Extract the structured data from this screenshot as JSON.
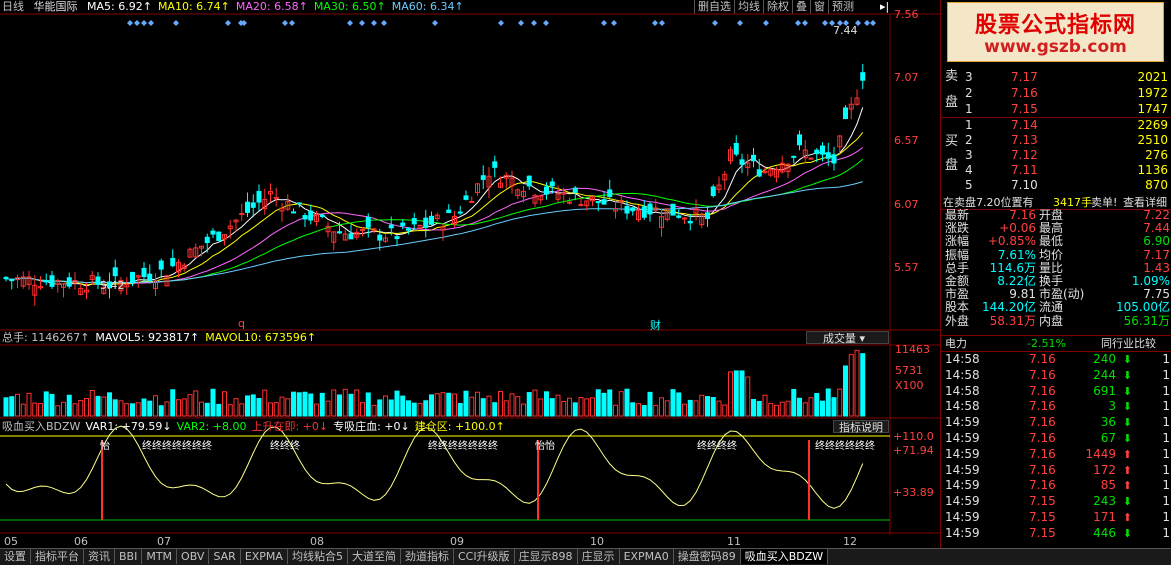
{
  "header": {
    "period": "日线",
    "stock": "华能国际",
    "ma": [
      {
        "label": "MA5: 6.92↑",
        "color": "#ffffff"
      },
      {
        "label": "MA10: 6.74↑",
        "color": "#ffff00"
      },
      {
        "label": "MA20: 6.58↑",
        "color": "#ff66ff"
      },
      {
        "label": "MA30: 6.50↑",
        "color": "#00ff00"
      },
      {
        "label": "MA60: 6.34↑",
        "color": "#66ccff"
      }
    ],
    "buttons": [
      "删自选",
      "均线",
      "除权",
      "叠",
      "窗",
      "预测"
    ],
    "play": "▸|"
  },
  "price_axis": [
    "7.56",
    "7.07",
    "6.57",
    "6.07",
    "5.57"
  ],
  "annotations": {
    "high": "7.44",
    "low": "5.42",
    "q": "q",
    "cai": "财"
  },
  "volume": {
    "header": [
      {
        "label": "总手: 1146267↑",
        "color": "#c0c0c0"
      },
      {
        "label": "MAVOL5: 923817↑",
        "color": "#ffffff"
      },
      {
        "label": "MAVOL10: 673596↑",
        "color": "#ffff00"
      }
    ],
    "button": "成交量 ▾",
    "axis": [
      "11463",
      "5731",
      "X100"
    ]
  },
  "indicator": {
    "header": [
      {
        "label": "吸血买入BDZW",
        "color": "#c0c0c0"
      },
      {
        "label": "VAR1: +79.59↓",
        "color": "#ffffff"
      },
      {
        "label": "VAR2: +8.00",
        "color": "#00ff00"
      },
      {
        "label": "上升在即: +0↓",
        "color": "#ff3030"
      },
      {
        "label": "专吸庄血: +0↓",
        "color": "#ffffff"
      },
      {
        "label": "建仓区: +100.0↑",
        "color": "#ffff00"
      }
    ],
    "button": "指标说明",
    "axis": [
      "+110.0",
      "+71.94",
      "+33.89"
    ],
    "labels": [
      "怡",
      "终终终终终终终",
      "终终终",
      "终终终终终终终",
      "怡怡",
      "终终终终",
      "终终终终终终"
    ]
  },
  "months": [
    "05",
    "06",
    "07",
    "08",
    "09",
    "10",
    "11",
    "12"
  ],
  "tabs": [
    "设置",
    "指标平台",
    "资讯",
    "BBI",
    "MTM",
    "OBV",
    "SAR",
    "EXPMA",
    "均线粘合5",
    "大道至简",
    "劲道指标",
    "CCI升级版",
    "庄显示898",
    "庄显示",
    "EXPMA0",
    "操盘密码89",
    "吸血买入BDZW"
  ],
  "ad": {
    "title": "股票公式指标网",
    "url": "www.gszb.com"
  },
  "orderbook": {
    "sell_label": "卖盘",
    "sell": [
      {
        "n": "3",
        "price": "7.17",
        "vol": "2021"
      },
      {
        "n": "2",
        "price": "7.16",
        "vol": "1972"
      },
      {
        "n": "1",
        "price": "7.15",
        "vol": "1747"
      }
    ],
    "buy_label": "买盘",
    "buy": [
      {
        "n": "1",
        "price": "7.14",
        "vol": "2269"
      },
      {
        "n": "2",
        "price": "7.13",
        "vol": "2510"
      },
      {
        "n": "3",
        "price": "7.12",
        "vol": "276"
      },
      {
        "n": "4",
        "price": "7.11",
        "vol": "1136"
      },
      {
        "n": "5",
        "price": "7.10",
        "vol": "870"
      }
    ],
    "notice": "在卖盘7.20位置有",
    "notice_vol": "3417手",
    "notice_tail": "卖单!",
    "notice_link": "查看详细"
  },
  "quote": [
    {
      "k1": "最新",
      "v1": "7.16",
      "c1": "#ff4040",
      "k2": "开盘",
      "v2": "7.22",
      "c2": "#ff4040"
    },
    {
      "k1": "涨跌",
      "v1": "+0.06",
      "c1": "#ff4040",
      "k2": "最高",
      "v2": "7.44",
      "c2": "#ff4040"
    },
    {
      "k1": "涨幅",
      "v1": "+0.85%",
      "c1": "#ff4040",
      "k2": "最低",
      "v2": "6.90",
      "c2": "#00e000"
    },
    {
      "k1": "振幅",
      "v1": "7.61%",
      "c1": "#00ffff",
      "k2": "均价",
      "v2": "7.17",
      "c2": "#ff4040"
    },
    {
      "k1": "总手",
      "v1": "114.6万",
      "c1": "#00ffff",
      "k2": "量比",
      "v2": "1.43",
      "c2": "#ff4040"
    },
    {
      "k1": "金额",
      "v1": "8.22亿",
      "c1": "#00ffff",
      "k2": "换手",
      "v2": "1.09%",
      "c2": "#00ffff"
    },
    {
      "k1": "市盈",
      "v1": "9.81",
      "c1": "#e0e0e0",
      "k2": "市盈(动)",
      "v2": "7.75",
      "c2": "#e0e0e0"
    },
    {
      "k1": "股本",
      "v1": "144.20亿",
      "c1": "#00ffff",
      "k2": "流通",
      "v2": "105.00亿",
      "c2": "#00ffff"
    },
    {
      "k1": "外盘",
      "v1": "58.31万",
      "c1": "#ff4040",
      "k2": "内盘",
      "v2": "56.31万",
      "c2": "#00e000"
    }
  ],
  "sector": {
    "name": "电力",
    "change": "-2.51%",
    "link": "同行业比较"
  },
  "ticks": [
    {
      "t": "14:58",
      "p": "7.16",
      "v": "240",
      "d": "down",
      "n": "1"
    },
    {
      "t": "14:58",
      "p": "7.16",
      "v": "244",
      "d": "down",
      "n": "1"
    },
    {
      "t": "14:58",
      "p": "7.16",
      "v": "691",
      "d": "down",
      "n": "1"
    },
    {
      "t": "14:58",
      "p": "7.16",
      "v": "3",
      "d": "down",
      "n": "1"
    },
    {
      "t": "14:59",
      "p": "7.16",
      "v": "36",
      "d": "down",
      "n": "1"
    },
    {
      "t": "14:59",
      "p": "7.16",
      "v": "67",
      "d": "down",
      "n": "1"
    },
    {
      "t": "14:59",
      "p": "7.16",
      "v": "1449",
      "d": "up",
      "n": "1"
    },
    {
      "t": "14:59",
      "p": "7.16",
      "v": "172",
      "d": "up",
      "n": "1"
    },
    {
      "t": "14:59",
      "p": "7.16",
      "v": "85",
      "d": "up",
      "n": "1"
    },
    {
      "t": "14:59",
      "p": "7.15",
      "v": "243",
      "d": "down",
      "n": "1"
    },
    {
      "t": "14:59",
      "p": "7.15",
      "v": "171",
      "d": "up",
      "n": "1"
    },
    {
      "t": "14:59",
      "p": "7.15",
      "v": "446",
      "d": "down",
      "n": "1"
    }
  ],
  "colors": {
    "up": "#ff3030",
    "down": "#00ffff",
    "grid": "#800000"
  }
}
